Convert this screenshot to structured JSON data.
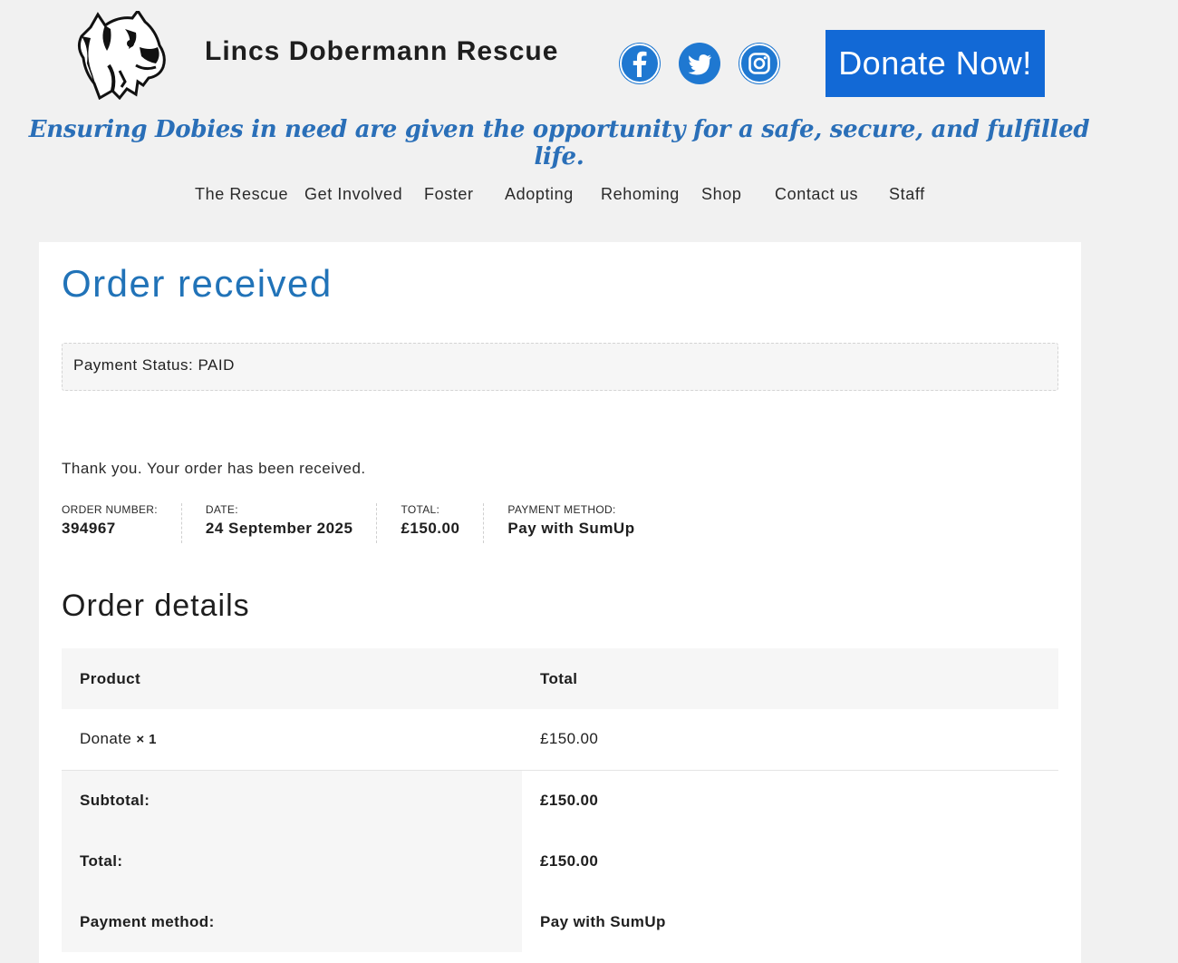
{
  "header": {
    "site_title": "Lincs Dobermann Rescue",
    "tagline": "Ensuring Dobies in need are given the opportunity for a safe, secure, and fulfilled life.",
    "donate_label": "Donate Now!",
    "social": [
      "facebook-icon",
      "twitter-icon",
      "instagram-icon"
    ],
    "brand_color": "#1269d6",
    "accent_color": "#2173b8"
  },
  "nav": {
    "items": [
      {
        "label": "The Rescue"
      },
      {
        "label": "Get Involved"
      },
      {
        "label": "Foster"
      },
      {
        "label": "Adopting"
      },
      {
        "label": "Rehoming"
      },
      {
        "label": "Shop"
      },
      {
        "label": "Contact us"
      },
      {
        "label": "Staff"
      }
    ]
  },
  "main": {
    "page_title": "Order received",
    "payment_status": "Payment Status: PAID",
    "thanks": "Thank you. Your order has been received.",
    "overview": [
      {
        "label": "ORDER NUMBER:",
        "value": "394967"
      },
      {
        "label": "DATE:",
        "value": "24 September 2025"
      },
      {
        "label": "TOTAL:",
        "value": "£150.00"
      },
      {
        "label": "PAYMENT METHOD:",
        "value": "Pay with SumUp"
      }
    ],
    "details_title": "Order details",
    "table": {
      "headers": [
        "Product",
        "Total"
      ],
      "rows": [
        {
          "product": "Donate",
          "qty": "× 1",
          "total": "£150.00"
        }
      ],
      "footer": [
        {
          "label": "Subtotal:",
          "value": "£150.00"
        },
        {
          "label": "Total:",
          "value": "£150.00"
        },
        {
          "label": "Payment method:",
          "value": "Pay with SumUp"
        }
      ]
    }
  }
}
